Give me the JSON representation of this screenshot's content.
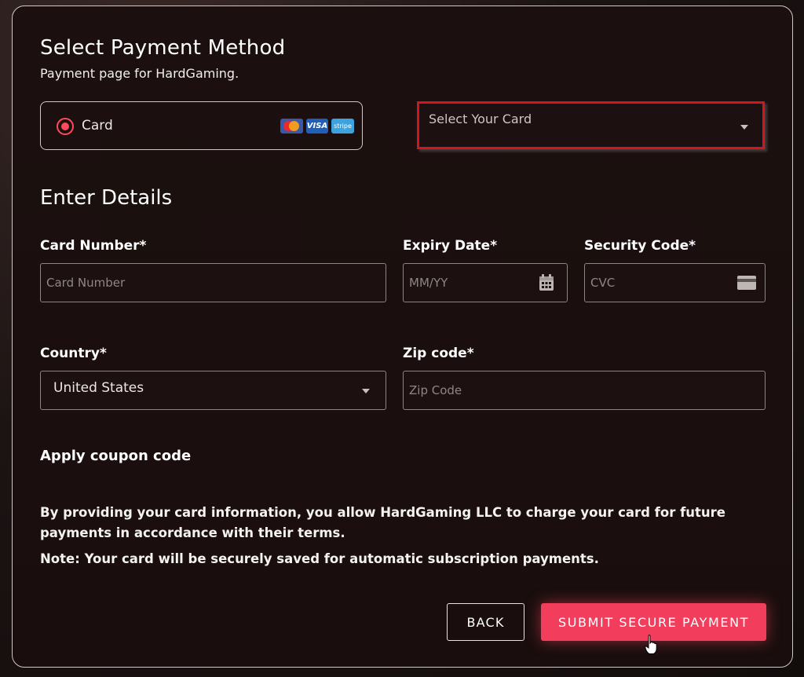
{
  "header": {
    "title": "Select Payment Method",
    "subtitle": "Payment page for HardGaming."
  },
  "payment_method": {
    "option_label": "Card",
    "selected": true,
    "brands": [
      "mastercard-icon",
      "visa-icon",
      "stripe-icon"
    ],
    "visa_text": "VISA",
    "stripe_text": "stripe"
  },
  "card_select": {
    "placeholder": "Select Your Card"
  },
  "details": {
    "section_title": "Enter Details",
    "card_number": {
      "label": "Card Number*",
      "placeholder": "Card Number",
      "value": ""
    },
    "expiry": {
      "label": "Expiry Date*",
      "placeholder": "MM/YY",
      "value": ""
    },
    "security_code": {
      "label": "Security Code*",
      "placeholder": "CVC",
      "value": ""
    },
    "country": {
      "label": "Country*",
      "value": "United States"
    },
    "zip": {
      "label": "Zip code*",
      "placeholder": "Zip Code",
      "value": ""
    }
  },
  "coupon": {
    "label": "Apply coupon code"
  },
  "terms": {
    "text": "By providing your card information, you allow HardGaming LLC to charge your card for future payments in accordance with their terms.",
    "note": "Note: Your card will be securely saved for automatic subscription payments."
  },
  "actions": {
    "back_label": "BACK",
    "submit_label": "SUBMIT SECURE PAYMENT"
  },
  "colors": {
    "accent": "#f23e5c",
    "radio": "#ff4a5a",
    "focus_border": "#d4151c"
  }
}
